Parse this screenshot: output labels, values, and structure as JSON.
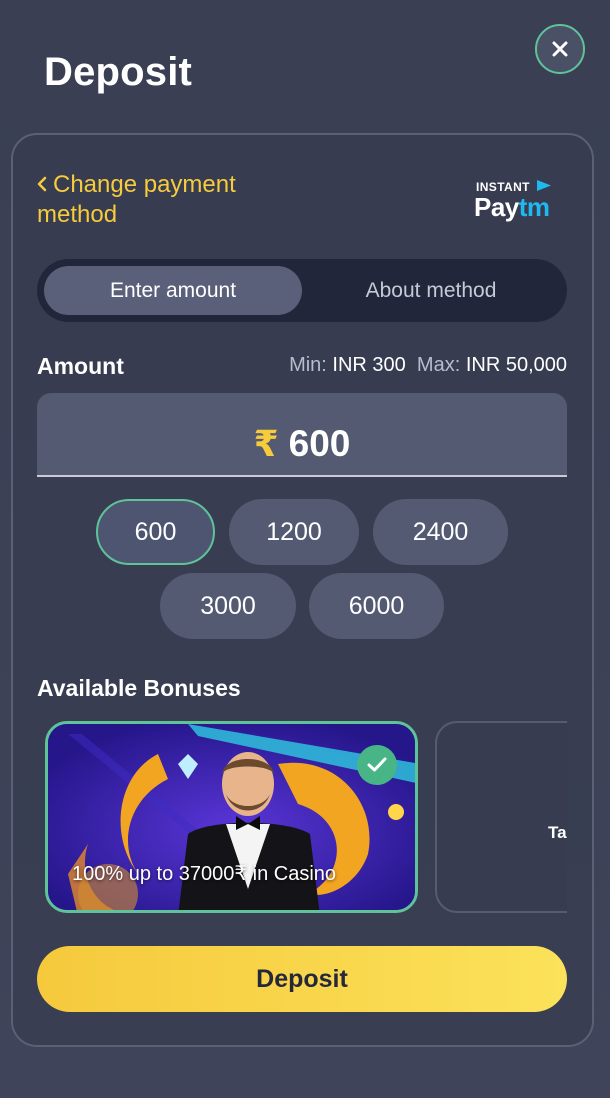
{
  "modal": {
    "title": "Deposit",
    "close_icon": "close-icon"
  },
  "payment": {
    "change_method_label": "Change payment method",
    "provider_logo": {
      "tag": "INSTANT",
      "word_part1": "Pay",
      "word_part2": "tm"
    }
  },
  "tabs": [
    {
      "label": "Enter amount",
      "active": true
    },
    {
      "label": "About method",
      "active": false
    }
  ],
  "amount": {
    "label": "Amount",
    "min_key": "Min:",
    "min_value": "INR 300",
    "max_key": "Max:",
    "max_value": "INR 50,000",
    "currency_symbol": "₹",
    "value": "600"
  },
  "quick_amounts": [
    {
      "label": "600",
      "selected": true
    },
    {
      "label": "1200",
      "selected": false
    },
    {
      "label": "2400",
      "selected": false
    },
    {
      "label": "3000",
      "selected": false
    },
    {
      "label": "6000",
      "selected": false
    }
  ],
  "bonuses": {
    "label": "Available Bonuses",
    "items": [
      {
        "text": "100% up to 37000₹ in Casino",
        "selected": true
      },
      {
        "text": "Ta",
        "selected": false
      }
    ]
  },
  "deposit_button": {
    "label": "Deposit"
  },
  "colors": {
    "accent_yellow": "#f6cb3c",
    "accent_green": "#5fc39a",
    "background": "#393e53"
  }
}
